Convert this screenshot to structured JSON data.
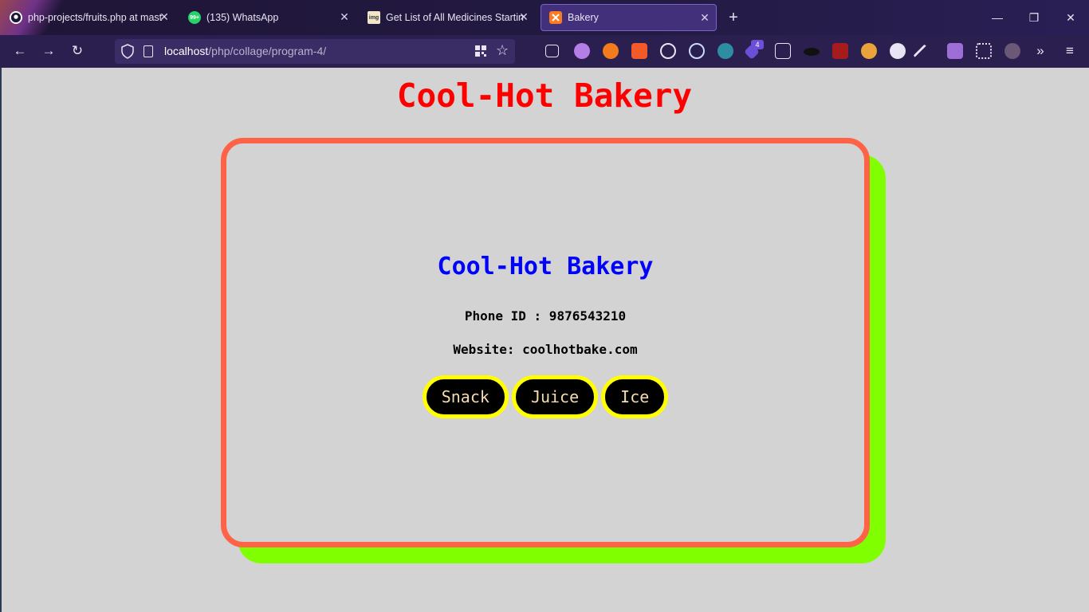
{
  "browser": {
    "tabs": [
      {
        "title": "php-projects/fruits.php at mast",
        "favicon": "github-icon"
      },
      {
        "title": "(135) WhatsApp",
        "favicon": "whatsapp-icon",
        "badge": "99+"
      },
      {
        "title": "Get List of All Medicines Startin",
        "favicon": "img-icon",
        "favicon_text": "img"
      },
      {
        "title": "Bakery",
        "favicon": "xampp-icon",
        "active": true
      }
    ],
    "url": {
      "host": "localhost",
      "path": "/php/collage/program-4/"
    },
    "extension_badge": "4"
  },
  "page": {
    "heading": "Cool-Hot Bakery",
    "card": {
      "title": "Cool-Hot Bakery",
      "phone": "Phone ID : 9876543210",
      "website": "Website: coolhotbake.com",
      "buttons": [
        {
          "label": "Snack"
        },
        {
          "label": "Juice"
        },
        {
          "label": "Ice"
        }
      ]
    }
  },
  "colors": {
    "heading": "#ff0000",
    "card_title": "#0000ff",
    "card_border": "#ff6347",
    "card_shadow": "#7fff00",
    "button_border": "#ffff00",
    "button_bg": "#000000",
    "page_bg": "#d3d3d3"
  }
}
